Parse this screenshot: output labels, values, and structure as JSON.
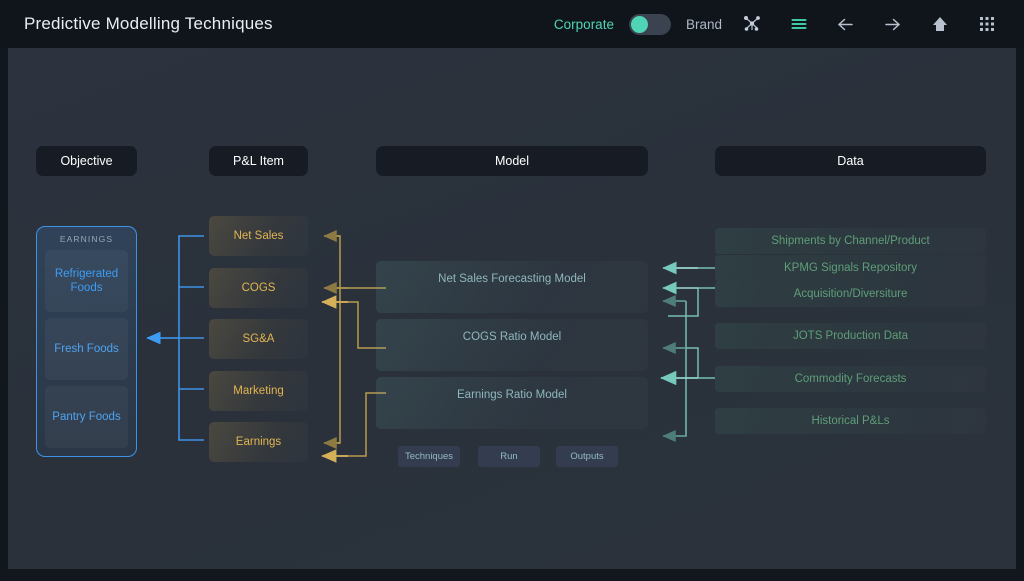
{
  "header": {
    "title": "Predictive Modelling Techniques",
    "segment_left": "Corporate",
    "segment_right": "Brand",
    "toggle_state": "left",
    "accent_color": "#4fd5b5",
    "icons": [
      {
        "name": "network-graph-icon",
        "label": "Network"
      },
      {
        "name": "hamburger-menu-icon",
        "label": "Menu"
      },
      {
        "name": "arrow-left-icon",
        "label": "Back"
      },
      {
        "name": "arrow-right-icon",
        "label": "Forward"
      },
      {
        "name": "home-icon",
        "label": "Home"
      },
      {
        "name": "apps-grid-icon",
        "label": "Apps"
      }
    ]
  },
  "columns": {
    "objective": {
      "header": "Objective",
      "card_title": "EARNINGS",
      "items": [
        {
          "label": "Refrigerated Foods"
        },
        {
          "label": "Fresh Foods"
        },
        {
          "label": "Pantry Foods"
        }
      ],
      "accent": "#3d93e8"
    },
    "pnl": {
      "header": "P&L Item",
      "items": [
        {
          "label": "Net Sales"
        },
        {
          "label": "COGS"
        },
        {
          "label": "SG&A"
        },
        {
          "label": "Marketing"
        },
        {
          "label": "Earnings"
        }
      ],
      "accent": "#e2b452"
    },
    "model": {
      "header": "Model",
      "items": [
        {
          "label": "Net Sales Forecasting Model"
        },
        {
          "label": "COGS Ratio Model"
        },
        {
          "label": "Earnings Ratio Model"
        }
      ],
      "buttons": [
        {
          "label": "Techniques"
        },
        {
          "label": "Run"
        },
        {
          "label": "Outputs"
        }
      ],
      "accent": "#8fb6bd"
    },
    "data": {
      "header": "Data",
      "items": [
        {
          "label": "Shipments by Channel/Product"
        },
        {
          "label": "KPMG Signals Repository"
        },
        {
          "label": "Acquisition/Diversiture"
        },
        {
          "label": "JOTS Production Data"
        },
        {
          "label": "Commodity Forecasts"
        },
        {
          "label": "Historical P&Ls"
        }
      ],
      "accent": "#5f9e79"
    }
  }
}
